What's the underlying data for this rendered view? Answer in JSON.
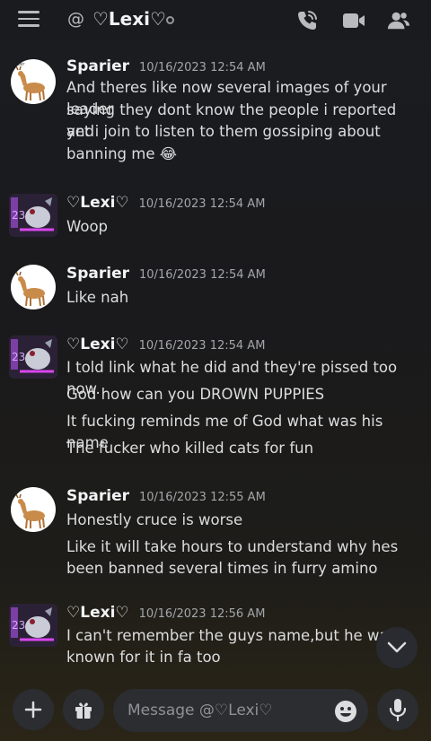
{
  "header": {
    "at_symbol": "@",
    "channel_name": "♡Lexi♡",
    "icons": [
      "menu-icon",
      "at-icon",
      "call-icon",
      "video-icon",
      "members-icon"
    ]
  },
  "messages": [
    {
      "author": "Sparier",
      "timestamp": "10/16/2023 12:54 AM",
      "lines": [
        "And theres like now several images of your leader",
        "saying they dont know the people i reported and",
        "yet i join to listen to them gossiping about",
        "banning me 😂"
      ]
    },
    {
      "author": "♡Lexi♡",
      "timestamp": "10/16/2023 12:54 AM",
      "lines": [
        "Woop"
      ]
    },
    {
      "author": "Sparier",
      "timestamp": "10/16/2023 12:54 AM",
      "lines": [
        "Like nah"
      ]
    },
    {
      "author": "♡Lexi♡",
      "timestamp": "10/16/2023 12:54 AM",
      "lines": [
        "I told link what he did and they're pissed too now.",
        "God how can you DROWN PUPPIES",
        "It fucking reminds me of God what was his name",
        "The fucker who killed cats for fun"
      ]
    },
    {
      "author": "Sparier",
      "timestamp": "10/16/2023 12:55 AM",
      "lines": [
        "Honestly cruce is worse",
        "Like it will take hours to understand why hes",
        "been banned several times in furry amino"
      ]
    },
    {
      "author": "♡Lexi♡",
      "timestamp": "10/16/2023 12:56 AM",
      "lines": [
        "I can't remember the guys name,but he was",
        "known for it in fa too"
      ]
    }
  ],
  "composer": {
    "placeholder": "Message @♡Lexi♡"
  },
  "colors": {
    "background": "#1a1b1e",
    "text": "#dcddde",
    "input_bg": "#2b2d31"
  }
}
